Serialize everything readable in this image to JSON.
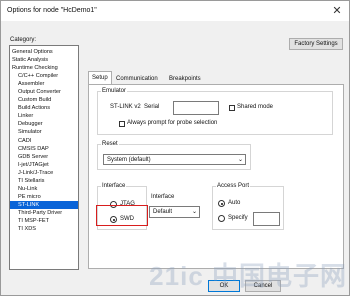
{
  "window": {
    "title": "Options for node \"HcDemo1\"",
    "close_icon": "close-icon"
  },
  "category": {
    "label": "Category:",
    "items": [
      {
        "label": "General Options",
        "indent": false
      },
      {
        "label": "Static Analysis",
        "indent": false
      },
      {
        "label": "Runtime Checking",
        "indent": false
      },
      {
        "label": "C/C++ Compiler",
        "indent": true
      },
      {
        "label": "Assembler",
        "indent": true
      },
      {
        "label": "Output Converter",
        "indent": true
      },
      {
        "label": "Custom Build",
        "indent": true
      },
      {
        "label": "Build Actions",
        "indent": true
      },
      {
        "label": "Linker",
        "indent": true
      },
      {
        "label": "Debugger",
        "indent": true
      },
      {
        "label": "Simulator",
        "indent": true
      },
      {
        "label": "CADI",
        "indent": true
      },
      {
        "label": "CMSIS DAP",
        "indent": true
      },
      {
        "label": "GDB Server",
        "indent": true
      },
      {
        "label": "I-jet/JTAGjet",
        "indent": true
      },
      {
        "label": "J-Link/J-Trace",
        "indent": true
      },
      {
        "label": "TI Stellaris",
        "indent": true
      },
      {
        "label": "Nu-Link",
        "indent": true
      },
      {
        "label": "PE micro",
        "indent": true
      },
      {
        "label": "ST-LINK",
        "indent": true,
        "selected": true
      },
      {
        "label": "Third-Party Driver",
        "indent": true
      },
      {
        "label": "TI MSP-FET",
        "indent": true
      },
      {
        "label": "TI XDS",
        "indent": true
      }
    ]
  },
  "factory_settings_label": "Factory Settings",
  "tabs": [
    {
      "label": "Setup",
      "active": true
    },
    {
      "label": "Communication",
      "active": false
    },
    {
      "label": "Breakpoints",
      "active": false
    }
  ],
  "emulator": {
    "label": "Emulator",
    "model_label": "ST-LINK v2",
    "serial_label": "Serial",
    "serial_value": "",
    "shared_mode_label": "Shared mode",
    "prompt_label": "Always prompt for probe selection"
  },
  "reset": {
    "label": "Reset",
    "value": "System (default)"
  },
  "interface": {
    "label": "Interface",
    "options": [
      {
        "label": "JTAG",
        "selected": false
      },
      {
        "label": "SWD",
        "selected": true
      }
    ]
  },
  "interface_speed": {
    "label": "Interface",
    "value": "Default"
  },
  "access_port": {
    "label": "Access Port",
    "auto_label": "Auto",
    "specify_label": "Specify",
    "specify_value": ""
  },
  "buttons": {
    "ok": "OK",
    "cancel": "Cancel"
  },
  "watermark": "21ic 中国电子网",
  "colors": {
    "selection": "#0a64d8",
    "highlight": "#d81e1e"
  }
}
